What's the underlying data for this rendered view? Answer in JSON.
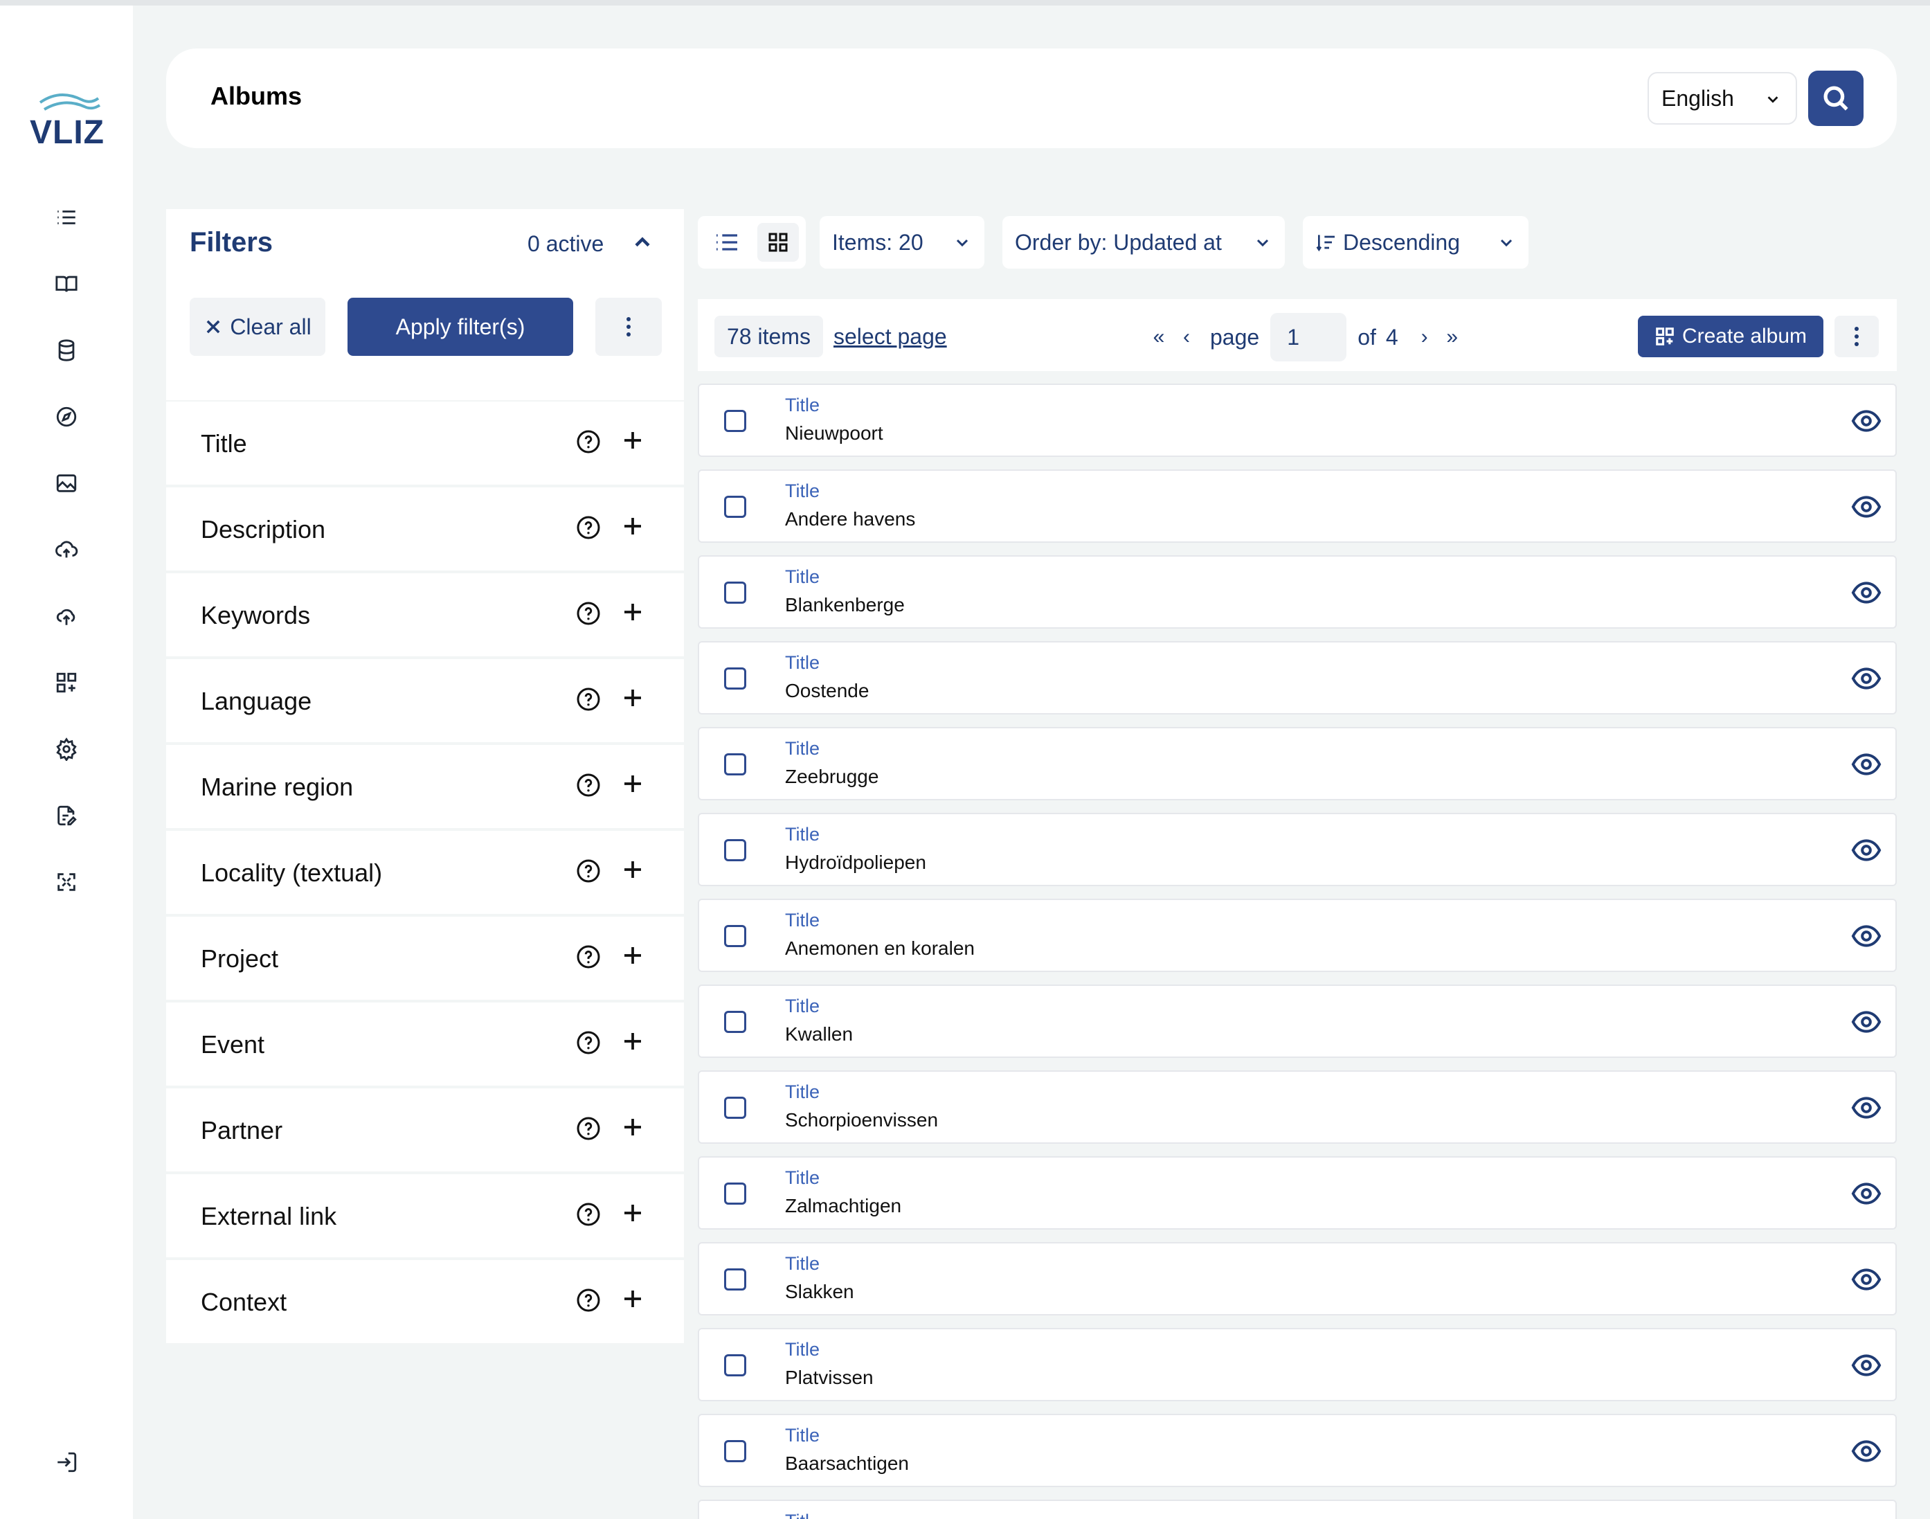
{
  "app": {
    "logo_text": "VLIZ"
  },
  "sidebar": {
    "items": [
      {
        "icon": "list-icon"
      },
      {
        "icon": "book-icon"
      },
      {
        "icon": "database-icon"
      },
      {
        "icon": "compass-icon"
      },
      {
        "icon": "image-icon"
      },
      {
        "icon": "cloud-upload-icon"
      },
      {
        "icon": "upload-icon"
      },
      {
        "icon": "album-grid-icon"
      },
      {
        "icon": "gear-icon"
      },
      {
        "icon": "document-edit-icon"
      },
      {
        "icon": "expand-icon"
      }
    ],
    "logout_icon": "logout-icon"
  },
  "header": {
    "title": "Albums",
    "language": "English"
  },
  "filters": {
    "title": "Filters",
    "active": "0 active",
    "clear_label": "Clear all",
    "apply_label": "Apply filter(s)",
    "items": [
      {
        "label": "Title"
      },
      {
        "label": "Description"
      },
      {
        "label": "Keywords"
      },
      {
        "label": "Language"
      },
      {
        "label": "Marine region"
      },
      {
        "label": "Locality (textual)"
      },
      {
        "label": "Project"
      },
      {
        "label": "Event"
      },
      {
        "label": "Partner"
      },
      {
        "label": "External link"
      },
      {
        "label": "Context"
      }
    ]
  },
  "toolbar": {
    "items_per_page": "Items: 20",
    "order_by": "Order by: Updated at",
    "direction": "Descending"
  },
  "results": {
    "count": "78 items",
    "select_page": "select page",
    "page_label": "page",
    "page_value": "1",
    "of_label": "of",
    "total_pages": "4",
    "create_label": "Create album"
  },
  "albums": [
    {
      "label": "Title",
      "value": "Nieuwpoort"
    },
    {
      "label": "Title",
      "value": "Andere havens"
    },
    {
      "label": "Title",
      "value": "Blankenberge"
    },
    {
      "label": "Title",
      "value": "Oostende"
    },
    {
      "label": "Title",
      "value": "Zeebrugge"
    },
    {
      "label": "Title",
      "value": "Hydroïdpoliepen"
    },
    {
      "label": "Title",
      "value": "Anemonen en koralen"
    },
    {
      "label": "Title",
      "value": "Kwallen"
    },
    {
      "label": "Title",
      "value": "Schorpioenvissen"
    },
    {
      "label": "Title",
      "value": "Zalmachtigen"
    },
    {
      "label": "Title",
      "value": "Slakken"
    },
    {
      "label": "Title",
      "value": "Platvissen"
    },
    {
      "label": "Title",
      "value": "Baarsachtigen"
    },
    {
      "label": "Titl",
      "value": ""
    }
  ],
  "colors": {
    "primary": "#2e4a8f",
    "text_accent": "#1f3b73",
    "label_blue": "#3b63b8",
    "background": "#f2f5f5"
  }
}
